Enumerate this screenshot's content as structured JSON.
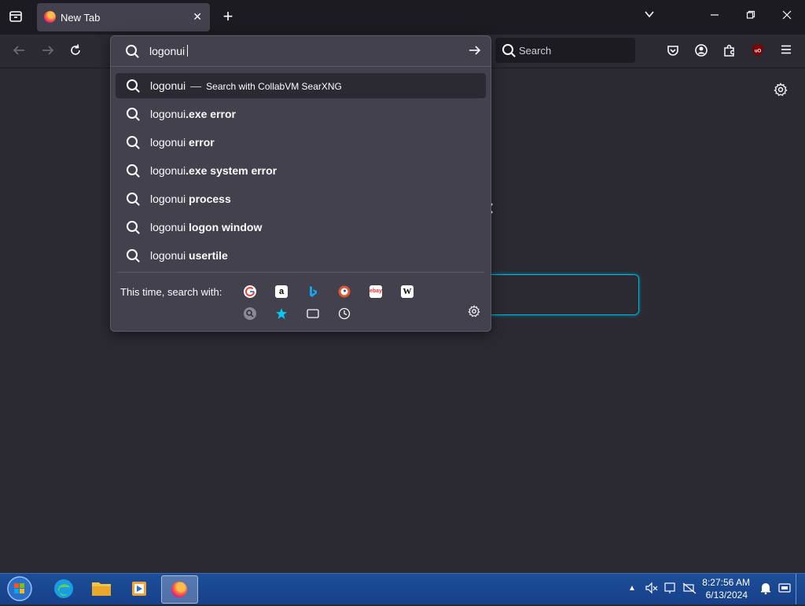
{
  "browser": {
    "tab": {
      "title": "New Tab"
    },
    "navbar": {
      "search_placeholder": "Search"
    }
  },
  "urlbar": {
    "typed": "logonui",
    "suggestions": [
      {
        "prefix": "logonui",
        "suffix": "",
        "note": "Search with CollabVM SearXNG"
      },
      {
        "prefix": "logonui",
        "suffix": ".exe error"
      },
      {
        "prefix": "logonui",
        "suffix": " error"
      },
      {
        "prefix": "logonui",
        "suffix": ".exe system error"
      },
      {
        "prefix": "logonui",
        "suffix": " process"
      },
      {
        "prefix": "logonui",
        "suffix": " logon window"
      },
      {
        "prefix": "logonui",
        "suffix": " usertile"
      }
    ],
    "this_time_label": "This time, search with:",
    "separator": "—"
  },
  "engines": [
    "google-icon",
    "amazon-icon",
    "bing-icon",
    "duckduckgo-icon",
    "ebay-icon",
    "wikipedia-icon",
    "searxng-icon",
    "bookmarks-icon",
    "tabs-icon",
    "history-icon"
  ],
  "engine_glyphs": {
    "amazon": "a",
    "ebay": "ebay",
    "wikipedia": "W"
  },
  "taskbar": {
    "time": "8:27:56 AM",
    "date": "6/13/2024"
  },
  "colors": {
    "accent": "#00b3d8",
    "popup_bg": "#42414d",
    "window_bg": "#2b2a33"
  }
}
